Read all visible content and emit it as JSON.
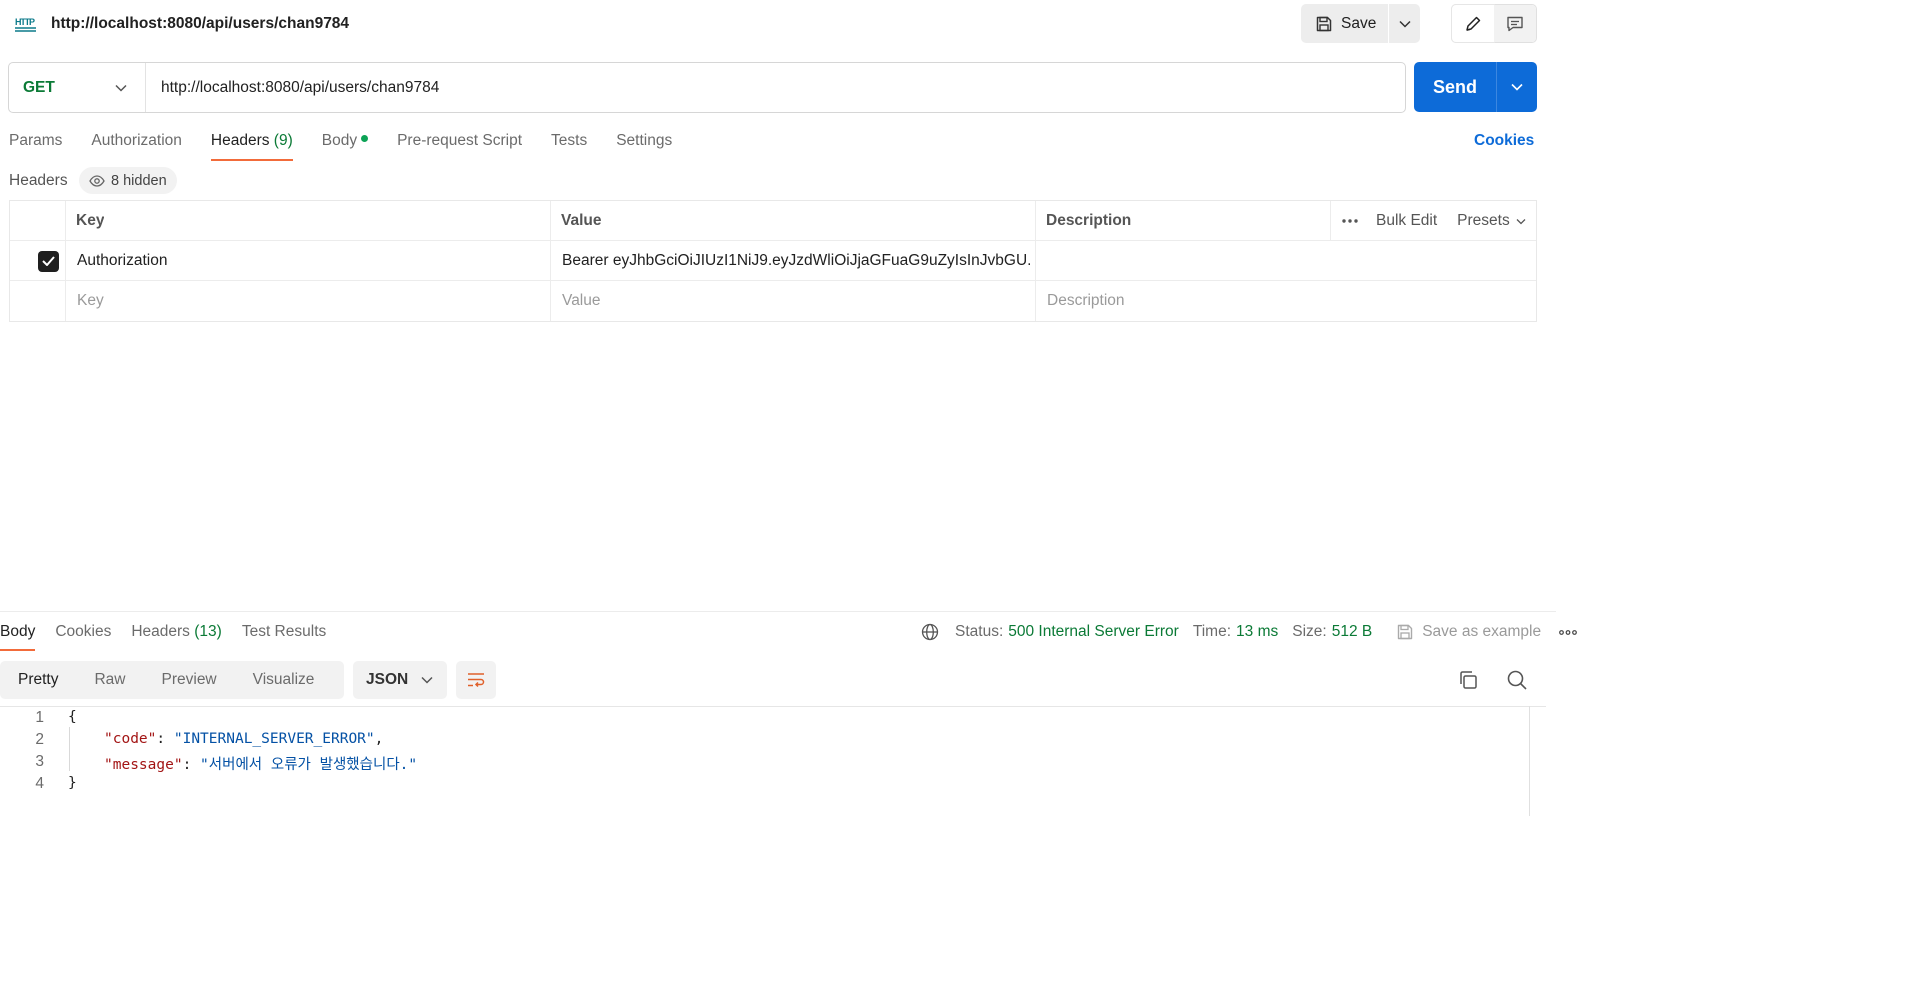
{
  "header": {
    "title": "http://localhost:8080/api/users/chan9784",
    "save_label": "Save"
  },
  "request": {
    "method": "GET",
    "url": "http://localhost:8080/api/users/chan9784",
    "send_label": "Send"
  },
  "request_tabs": [
    {
      "label": "Params"
    },
    {
      "label": "Authorization"
    },
    {
      "label": "Headers",
      "count": "(9)"
    },
    {
      "label": "Body"
    },
    {
      "label": "Pre-request Script"
    },
    {
      "label": "Tests"
    },
    {
      "label": "Settings"
    }
  ],
  "cookies_label": "Cookies",
  "headers_section": {
    "label": "Headers",
    "hidden_label": "8 hidden",
    "columns": {
      "key": "Key",
      "value": "Value",
      "description": "Description"
    },
    "bulk_edit": "Bulk Edit",
    "presets": "Presets",
    "rows": [
      {
        "key": "Authorization",
        "value": "Bearer eyJhbGciOiJIUzI1NiJ9.eyJzdWliOiJjaGFuaG9uZyIsInJvbGU...",
        "description": ""
      }
    ],
    "placeholders": {
      "key": "Key",
      "value": "Value",
      "description": "Description"
    }
  },
  "response": {
    "tabs": [
      {
        "label": "Body"
      },
      {
        "label": "Cookies"
      },
      {
        "label": "Headers",
        "count": "(13)"
      },
      {
        "label": "Test Results"
      }
    ],
    "status_label": "Status:",
    "status_value": "500 Internal Server Error",
    "time_label": "Time:",
    "time_value": "13 ms",
    "size_label": "Size:",
    "size_value": "512 B",
    "save_example": "Save as example",
    "views": [
      "Pretty",
      "Raw",
      "Preview",
      "Visualize"
    ],
    "format": "JSON",
    "code_lines": [
      {
        "n": "1",
        "open": "{"
      },
      {
        "n": "2",
        "key": "\"code\"",
        "sep": ": ",
        "val": "\"INTERNAL_SERVER_ERROR\"",
        "end": ","
      },
      {
        "n": "3",
        "key": "\"message\"",
        "sep": ": ",
        "val": "\"서버에서 오류가 발생했습니다.\"",
        "end": ""
      },
      {
        "n": "4",
        "open": "}"
      }
    ]
  },
  "colors": {
    "accent": "#0d6bd8",
    "method_get": "#0b7a36",
    "active_tab_underline": "#f26b3a",
    "status_error": "#0b7a36",
    "body_dot": "#0ca356"
  }
}
